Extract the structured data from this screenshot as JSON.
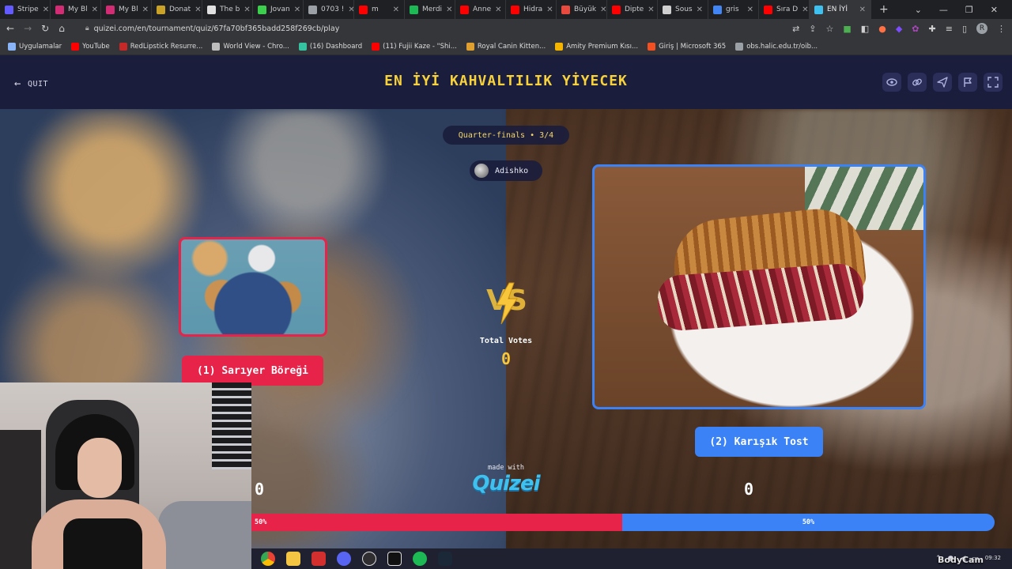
{
  "browser": {
    "tabs": [
      {
        "label": "Stripe",
        "color": "#635bff"
      },
      {
        "label": "My Bl",
        "color": "#d22c74"
      },
      {
        "label": "My Bl",
        "color": "#d22c74"
      },
      {
        "label": "Donat",
        "color": "#c9a227"
      },
      {
        "label": "The b",
        "color": "#e0e0e0"
      },
      {
        "label": "Jovan",
        "color": "#3ccf4e"
      },
      {
        "label": "0703 !",
        "color": "#9aa0a6"
      },
      {
        "label": "m",
        "color": "#ff0000"
      },
      {
        "label": "Merdi",
        "color": "#1db954"
      },
      {
        "label": "Anne",
        "color": "#ff0000"
      },
      {
        "label": "Hidra",
        "color": "#ff0000"
      },
      {
        "label": "Büyük",
        "color": "#e84a3d"
      },
      {
        "label": "Dipte",
        "color": "#ff0000"
      },
      {
        "label": "Sous",
        "color": "#cfcfcf"
      },
      {
        "label": "gris",
        "color": "#4285f4"
      },
      {
        "label": "Sıra D",
        "color": "#ff0000"
      },
      {
        "label": "EN İYİ",
        "color": "#3fc1ef",
        "active": true
      }
    ],
    "new_tab": "+",
    "url": "quizei.com/en/tournament/quiz/67fa70bf365badd258f269cb/play",
    "profile_initial": "R",
    "bookmarks": [
      {
        "label": "Uygulamalar",
        "color": "#8ab4f8"
      },
      {
        "label": "YouTube",
        "color": "#ff0000"
      },
      {
        "label": "RedLipstick Resurre...",
        "color": "#c62828"
      },
      {
        "label": "World View - Chro...",
        "color": "#bdbdbd"
      },
      {
        "label": "(16) Dashboard",
        "color": "#35c2a0"
      },
      {
        "label": "(11) Fujii Kaze - \"Shi...",
        "color": "#ff0000"
      },
      {
        "label": "Royal Canin Kitten...",
        "color": "#e0a030"
      },
      {
        "label": "Amity Premium Kısı...",
        "color": "#f4b400"
      },
      {
        "label": "Giriş | Microsoft 365",
        "color": "#f25022"
      },
      {
        "label": "obs.halic.edu.tr/oib...",
        "color": "#9aa0a6"
      }
    ]
  },
  "header": {
    "quit_label": "QUIT",
    "title": "EN İYİ KAHVALTILIK YİYECEK",
    "icons": [
      "eye-icon",
      "link-icon",
      "share-icon",
      "flag-icon",
      "fullscreen-icon"
    ]
  },
  "match": {
    "round": "Quarter-finals • 3/4",
    "creator": "Adishko",
    "vs_text": "VS",
    "total_votes_label": "Total Votes",
    "total_votes": "0",
    "left": {
      "label": "(1) Sarıyer Böreği",
      "votes": "0",
      "percent_text": "50%",
      "share": 0.5,
      "color": "#e8234a"
    },
    "right": {
      "label": "(2) Karışık Tost",
      "votes": "0",
      "percent_text": "50%",
      "share": 0.5,
      "color": "#3b82f6"
    },
    "made_with": "made with",
    "brand": "Quizei"
  },
  "taskbar": {
    "time": "09:32",
    "watermark": "BodyCam"
  }
}
